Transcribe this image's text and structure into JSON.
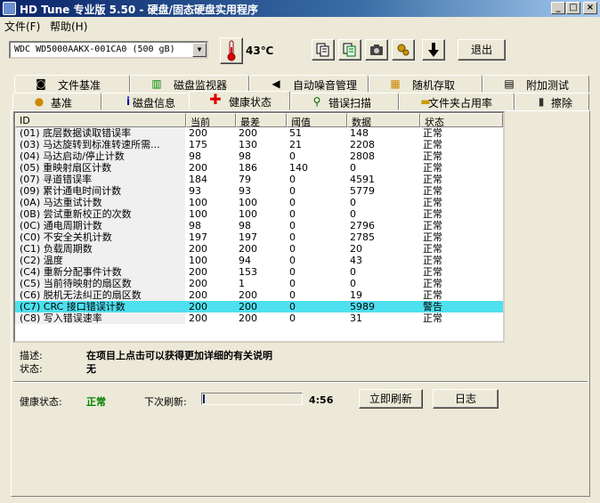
{
  "window": {
    "title": "HD Tune 专业版 5.50 - 硬盘/固态硬盘实用程序"
  },
  "menu": {
    "file": "文件(F)",
    "help": "帮助(H)"
  },
  "toolbar": {
    "drive": "WDC WD5000AAKX-001CA0 (500 gB)",
    "temperature": "43℃",
    "exit_label": "退出"
  },
  "tabs": {
    "top": [
      "文件基准",
      "磁盘监视器",
      "自动噪音管理",
      "随机存取",
      "附加测试"
    ],
    "bottom": [
      "基准",
      "磁盘信息",
      "健康状态",
      "错误扫描",
      "文件夹占用率",
      "擦除"
    ],
    "active": "健康状态"
  },
  "table": {
    "headers": [
      "ID",
      "当前",
      "最差",
      "阈值",
      "数据",
      "状态"
    ],
    "rows": [
      {
        "id": "(01) 底层数据读取错误率",
        "current": "200",
        "worst": "200",
        "threshold": "51",
        "data": "148",
        "status": "正常"
      },
      {
        "id": "(03) 马达旋转到标准转速所需...",
        "current": "175",
        "worst": "130",
        "threshold": "21",
        "data": "2208",
        "status": "正常"
      },
      {
        "id": "(04) 马达启动/停止计数",
        "current": "98",
        "worst": "98",
        "threshold": "0",
        "data": "2808",
        "status": "正常"
      },
      {
        "id": "(05) 重映射扇区计数",
        "current": "200",
        "worst": "186",
        "threshold": "140",
        "data": "0",
        "status": "正常"
      },
      {
        "id": "(07) 寻道错误率",
        "current": "184",
        "worst": "79",
        "threshold": "0",
        "data": "4591",
        "status": "正常"
      },
      {
        "id": "(09) 累计通电时间计数",
        "current": "93",
        "worst": "93",
        "threshold": "0",
        "data": "5779",
        "status": "正常"
      },
      {
        "id": "(0A) 马达重试计数",
        "current": "100",
        "worst": "100",
        "threshold": "0",
        "data": "0",
        "status": "正常"
      },
      {
        "id": "(0B) 尝试重新校正的次数",
        "current": "100",
        "worst": "100",
        "threshold": "0",
        "data": "0",
        "status": "正常"
      },
      {
        "id": "(0C) 通电周期计数",
        "current": "98",
        "worst": "98",
        "threshold": "0",
        "data": "2796",
        "status": "正常"
      },
      {
        "id": "(C0) 不安全关机计数",
        "current": "197",
        "worst": "197",
        "threshold": "0",
        "data": "2785",
        "status": "正常"
      },
      {
        "id": "(C1) 负载周期数",
        "current": "200",
        "worst": "200",
        "threshold": "0",
        "data": "20",
        "status": "正常"
      },
      {
        "id": "(C2) 温度",
        "current": "100",
        "worst": "94",
        "threshold": "0",
        "data": "43",
        "status": "正常"
      },
      {
        "id": "(C4) 重新分配事件计数",
        "current": "200",
        "worst": "153",
        "threshold": "0",
        "data": "0",
        "status": "正常"
      },
      {
        "id": "(C5) 当前待映射的扇区数",
        "current": "200",
        "worst": "1",
        "threshold": "0",
        "data": "0",
        "status": "正常"
      },
      {
        "id": "(C6) 脱机无法纠正的扇区数",
        "current": "200",
        "worst": "200",
        "threshold": "0",
        "data": "19",
        "status": "正常"
      },
      {
        "id": "(C7) CRC 接口错误计数",
        "current": "200",
        "worst": "200",
        "threshold": "0",
        "data": "5989",
        "status": "警告",
        "warn": true
      },
      {
        "id": "(C8) 写入错误速率",
        "current": "200",
        "worst": "200",
        "threshold": "0",
        "data": "31",
        "status": "正常"
      }
    ]
  },
  "details": {
    "desc_label": "描述:",
    "desc_value": "在项目上点击可以获得更加详细的有关说明",
    "status_label": "状态:",
    "status_value": "无"
  },
  "footer": {
    "health_label": "健康状态:",
    "health_value": "正常",
    "next_refresh_label": "下次刷新:",
    "refresh_progress": 0.02,
    "countdown": "4:56",
    "refresh_now_label": "立即刷新",
    "log_label": "日志"
  },
  "colors": {
    "health_ok": "#008000",
    "warn_row": "#4ee0ee"
  }
}
